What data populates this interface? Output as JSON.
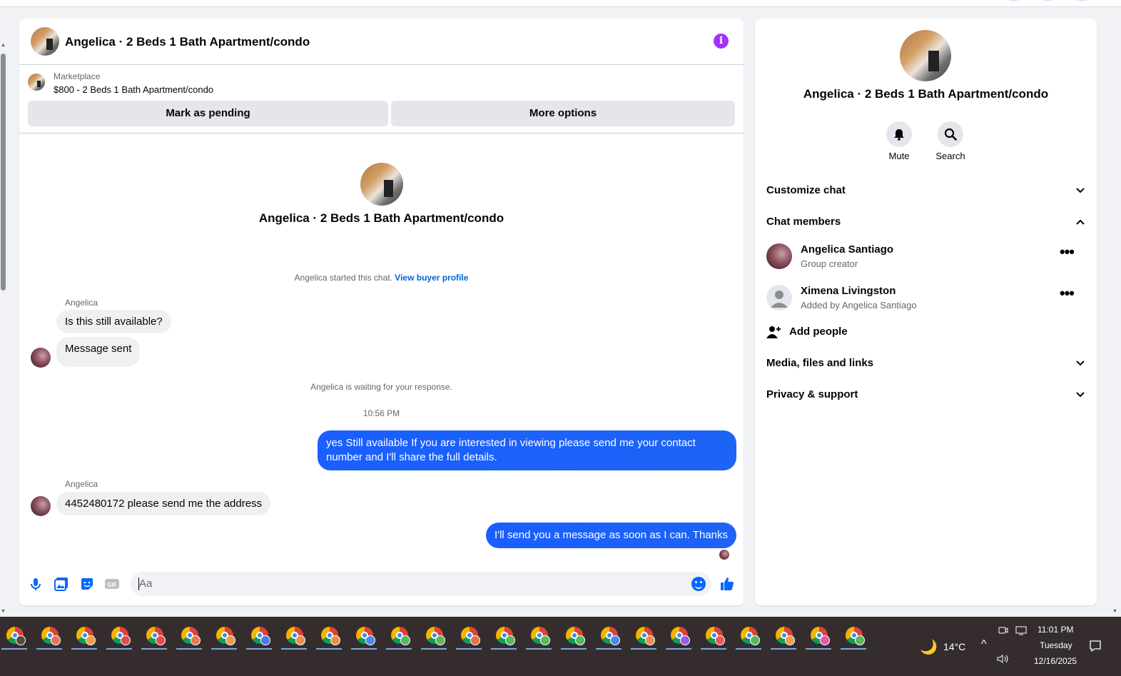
{
  "chat": {
    "header_title": "Angelica · 2 Beds 1 Bath Apartment/condo",
    "marketplace_label": "Marketplace",
    "listing_line": "$800 - 2 Beds 1 Bath Apartment/condo",
    "mark_pending_label": "Mark as pending",
    "more_options_label": "More options",
    "intro_title": "Angelica · 2 Beds 1 Bath Apartment/condo",
    "started_note": "Angelica started this chat.",
    "view_buyer_profile": "View buyer profile",
    "messages": [
      {
        "sender": "Angelica",
        "text": "Is this still available?"
      },
      {
        "text": "Message sent"
      },
      {
        "text": "yes Still available If you are interested in viewing please send me your contact number and I'll share the full details."
      },
      {
        "sender": "Angelica",
        "text": "4452480172 please send me the address"
      },
      {
        "text": "I'll send you a message as soon as I can. Thanks"
      }
    ],
    "waiting_note": "Angelica is waiting for your response.",
    "timestamp": "10:56 PM",
    "composer_placeholder": "Aa"
  },
  "info_panel": {
    "name": "Angelica · 2 Beds 1 Bath Apartment/condo",
    "mute_label": "Mute",
    "search_label": "Search",
    "customize_chat": "Customize chat",
    "chat_members": "Chat members",
    "members": [
      {
        "name": "Angelica Santiago",
        "role": "Group creator"
      },
      {
        "name": "Ximena Livingston",
        "role": "Added by Angelica Santiago"
      }
    ],
    "add_people": "Add people",
    "media_files_links": "Media, files and links",
    "privacy_support": "Privacy & support"
  },
  "taskbar": {
    "weather": "14°C",
    "time": "11:01 PM",
    "day": "Tuesday",
    "date": "12/16/2025",
    "app_badge_colors": [
      "#5a4a3a",
      "#e8715a",
      "#e8a04a",
      "#e84a4a",
      "#e84a4a",
      "#e87a4a",
      "#e8a04a",
      "#4a7ae8",
      "#e8904a",
      "#e8904a",
      "#4a8ae8",
      "#5ab85a",
      "#5ab85a",
      "#e8714a",
      "#5ab85a",
      "#5ab85a",
      "#5ab85a",
      "#4a8ae8",
      "#e8904a",
      "#a05ae8",
      "#e85a5a",
      "#5ab85a",
      "#e8a04a",
      "#e85aa0",
      "#5ab85a"
    ]
  },
  "colors": {
    "accent": "#0866ff",
    "outgoing_bubble": "#1a5fff",
    "info_icon": "#a033ff",
    "taskbar": "#352d2d"
  }
}
